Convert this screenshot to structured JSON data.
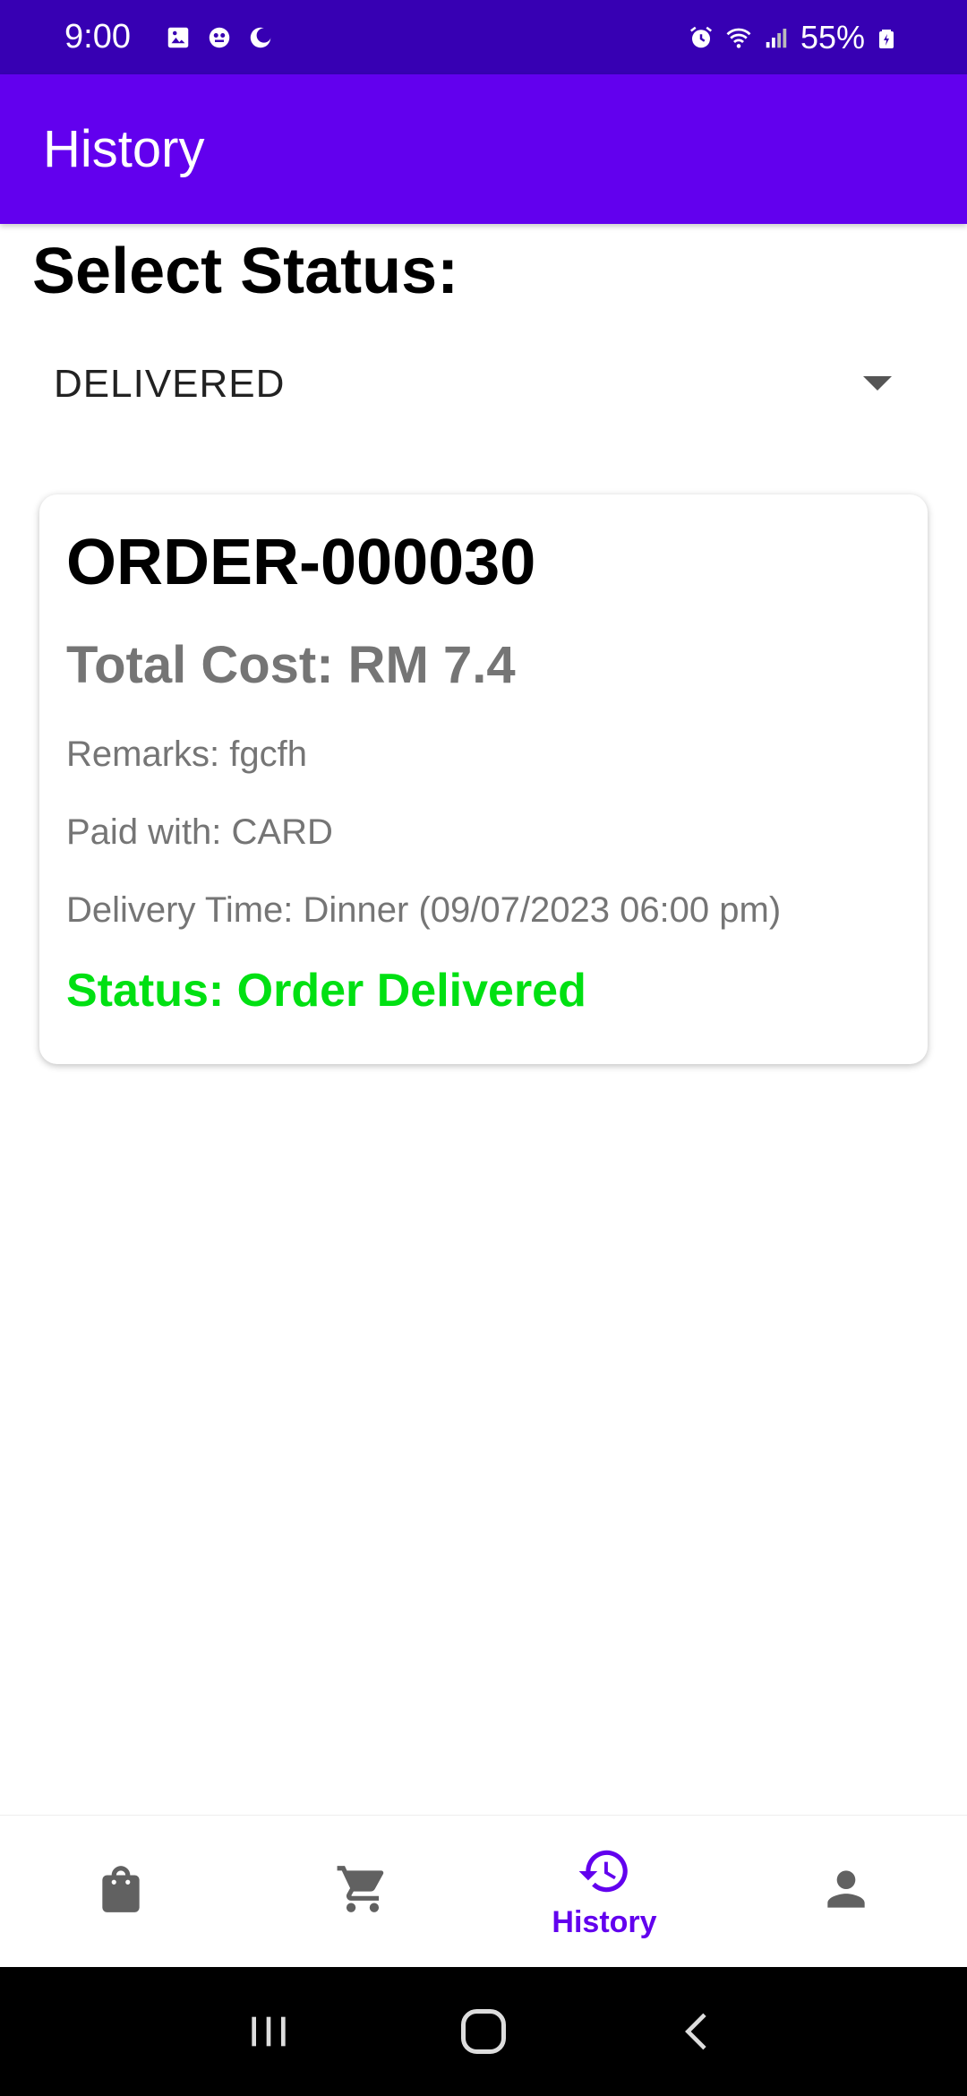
{
  "status_bar": {
    "time": "9:00",
    "battery": "55%",
    "icons": [
      "gallery-icon",
      "notification-icon",
      "moon-icon",
      "alarm-icon",
      "wifi-icon",
      "signal-icon",
      "battery-icon"
    ]
  },
  "app_bar": {
    "title": "History"
  },
  "filter": {
    "label": "Select Status:",
    "selected": "DELIVERED"
  },
  "orders": [
    {
      "id": "ORDER-000030",
      "total": "Total Cost: RM 7.4",
      "remarks": "Remarks: fgcfh",
      "paid": "Paid with: CARD",
      "delivery_time": "Delivery Time: Dinner (09/07/2023 06:00 pm)",
      "status": "Status: Order Delivered"
    }
  ],
  "bottom_nav": {
    "items": [
      {
        "icon": "shopping-bag-icon",
        "label": "",
        "active": false
      },
      {
        "icon": "cart-icon",
        "label": "",
        "active": false
      },
      {
        "icon": "history-icon",
        "label": "History",
        "active": true
      },
      {
        "icon": "person-icon",
        "label": "",
        "active": false
      }
    ]
  },
  "colors": {
    "status_bar": "#3700b3",
    "app_bar": "#6200ee",
    "accent": "#6200ee",
    "status_delivered": "#00e012",
    "inactive_icon": "#616161"
  }
}
